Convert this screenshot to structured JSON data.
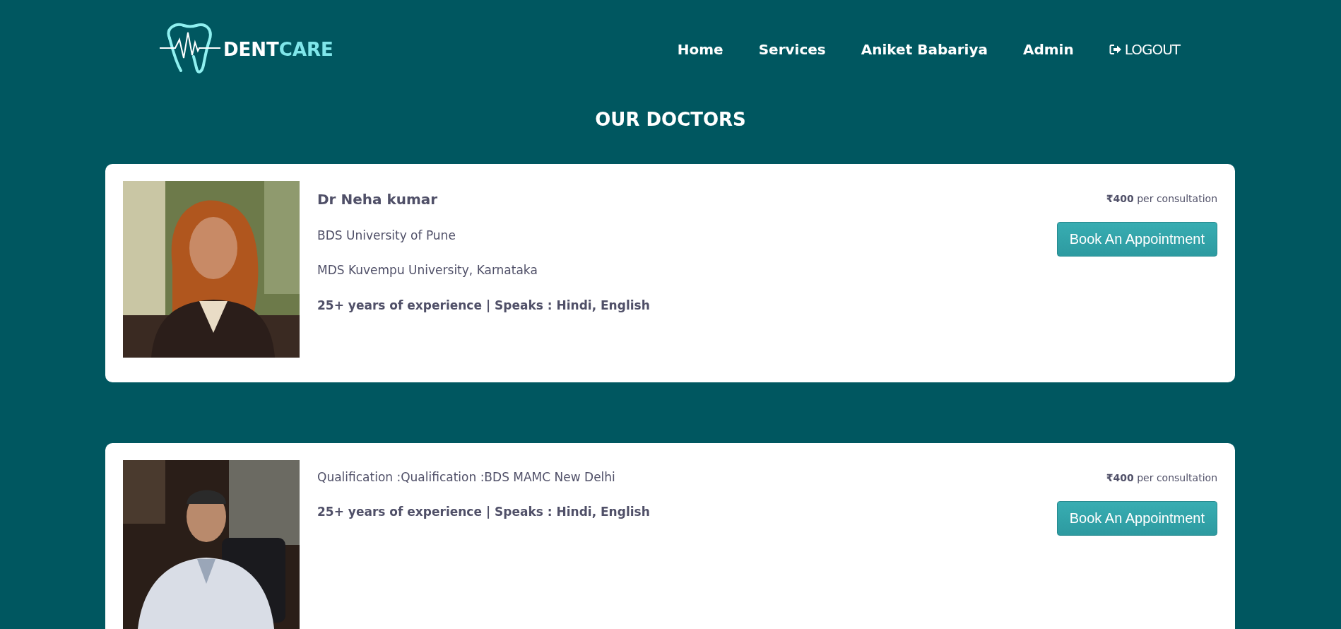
{
  "header": {
    "brand": {
      "first": "DENT",
      "second": "CARE"
    },
    "nav": [
      {
        "label": "Home",
        "kind": "link"
      },
      {
        "label": "Services",
        "kind": "link"
      },
      {
        "label": "Aniket Babariya",
        "kind": "link"
      },
      {
        "label": "Admin",
        "kind": "link"
      },
      {
        "label": "LOGOUT",
        "kind": "logout"
      }
    ]
  },
  "title": "OUR DOCTORS",
  "doctors": [
    {
      "photo": {
        "kind": "picture"
      },
      "name": "Dr Neha kumar",
      "qualifications": [
        "BDS University of Pune",
        "MDS Kuvempu University, Karnataka"
      ],
      "experience": "25+ years of experience | Speaks : Hindi, English",
      "price": "**₹400** per consultation",
      "button": "Book An Appointment"
    },
    {
      "photo": {
        "kind": "picture"
      },
      "qualifications": [
        "Qualification :Qualification :BDS MAMC New Delhi"
      ],
      "experience": "25+ years of experience | Speaks : Hindi, English",
      "price": "**₹400** per consultation",
      "button": "Book An Appointment"
    }
  ]
}
